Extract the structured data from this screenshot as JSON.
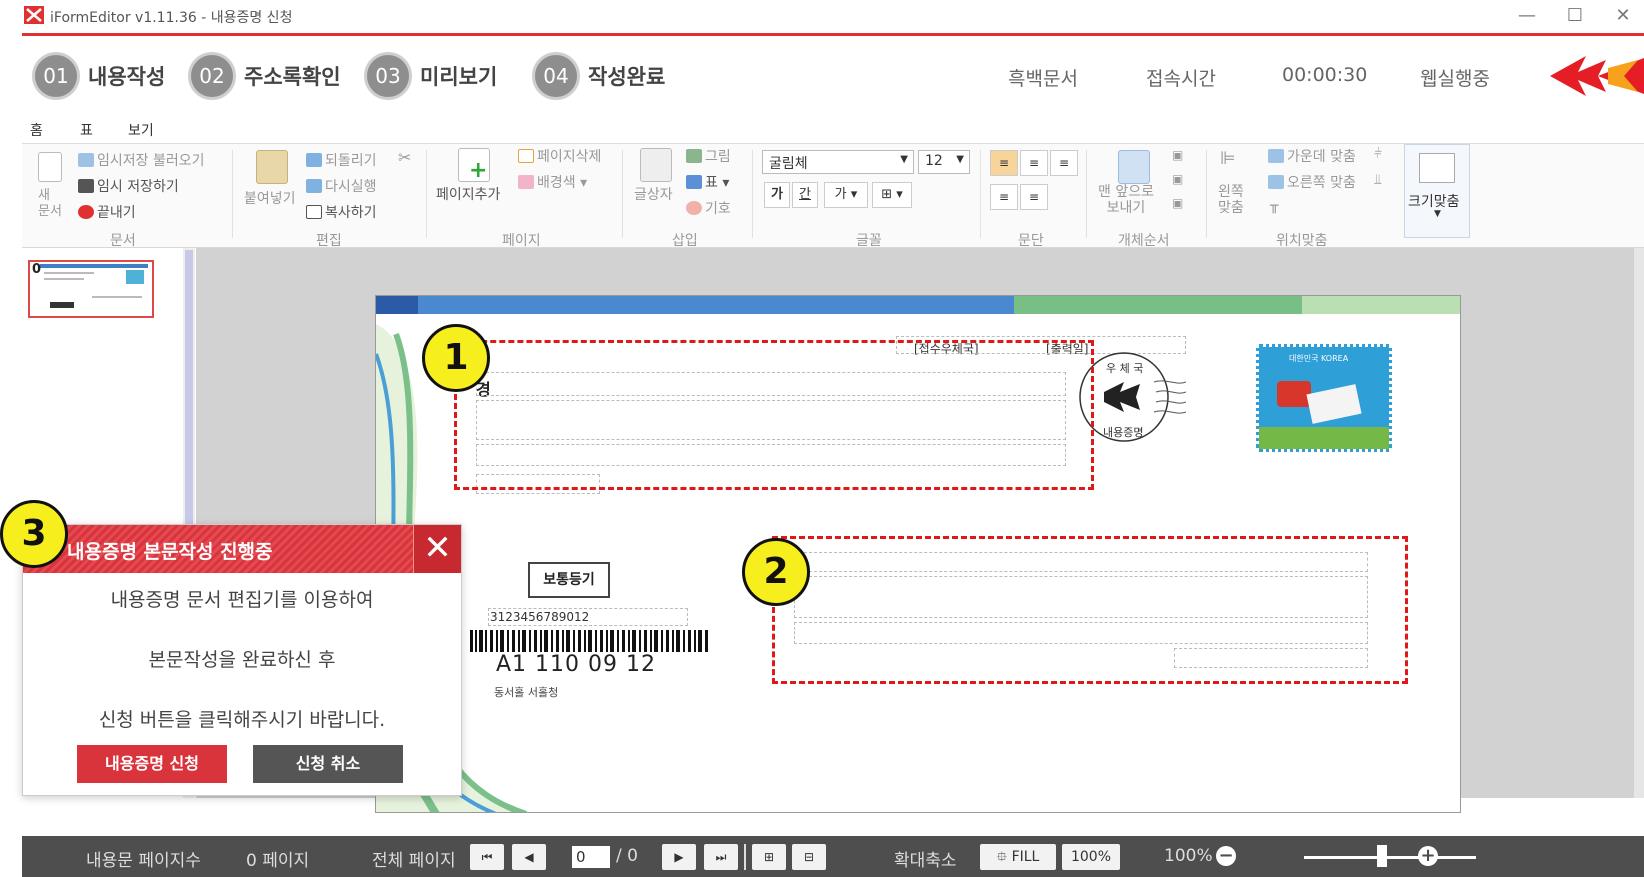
{
  "window": {
    "title": "iFormEditor v1.11.36 - 내용증명 신청",
    "minimize": "—",
    "maximize": "☐",
    "close": "✕"
  },
  "steps": [
    {
      "num": "01",
      "label": "내용작성"
    },
    {
      "num": "02",
      "label": "주소록확인"
    },
    {
      "num": "03",
      "label": "미리보기"
    },
    {
      "num": "04",
      "label": "작성완료"
    }
  ],
  "header": {
    "doc_type": "흑백문서",
    "conn_label": "접속시간",
    "conn_time": "00:00:30",
    "web_status": "웹실행중"
  },
  "tabs": [
    "홈",
    "표",
    "보기"
  ],
  "ribbon": {
    "doc": {
      "new": "새\n문서",
      "load": "임시저장 불러오기",
      "save": "임시 저장하기",
      "exit": "끝내기",
      "group": "문서"
    },
    "edit": {
      "paste": "붙여넣기",
      "undo": "되돌리기",
      "redo": "다시실행",
      "copy": "복사하기",
      "group": "편집"
    },
    "page": {
      "add": "페이지추가",
      "delete": "페이지삭제",
      "bgcolor": "배경색",
      "group": "페이지"
    },
    "insert": {
      "textbox": "글상자",
      "image": "그림",
      "table": "표",
      "symbol": "기호",
      "group": "삽입"
    },
    "font": {
      "name": "굴림체",
      "size": "12",
      "bold": "가",
      "underline": "간",
      "color": "가",
      "group": "글꼴"
    },
    "para": {
      "group": "문단"
    },
    "order": {
      "front": "맨 앞으로\n보내기",
      "group": "개체순서"
    },
    "position": {
      "left": "왼쪽\n맞춤",
      "center": "가운데 맞춤",
      "right": "오른쪽 맞춤",
      "group": "위치맞춤"
    },
    "fit": {
      "label": "크기맞춤"
    }
  },
  "thumbnail": {
    "num": "0"
  },
  "document": {
    "receipt_office": "[접수우체국]",
    "print_date": "[출력일]",
    "sender_prefix": "경",
    "postmark_top": "우 체 국",
    "postmark_bottom": "내용증명",
    "stamp_text": "대한민국 KOREA",
    "regular_mail": "보통등기",
    "barcode_number": "3123456789012",
    "tracking": "A1 110 09 12",
    "office_small": "동서홀  서홀청"
  },
  "markers": [
    "1",
    "2",
    "3"
  ],
  "dialog": {
    "title": "내용증명 본문작성 진행중",
    "close": "✕",
    "line1": "내용증명 문서 편집기를 이용하여",
    "line2": "본문작성을 완료하신 후",
    "line3": "신청 버튼을 클릭해주시기 바랍니다.",
    "apply": "내용증명 신청",
    "cancel": "신청 취소"
  },
  "status": {
    "pages_label": "내용문 페이지수",
    "pages_value": "0 페이지",
    "total_label": "전체 페이지",
    "current_page": "0",
    "total_pages": "/ 0",
    "zoom_label": "확대축소",
    "fill": "FILL",
    "hundred": "100%",
    "zoom_value": "100%"
  },
  "colors": {
    "accent_red": "#e03131",
    "step_circle": "#8e8e8e",
    "marker_yellow": "#f7ee1d",
    "dialog_apply": "#d9333b",
    "dialog_cancel": "#555555"
  }
}
